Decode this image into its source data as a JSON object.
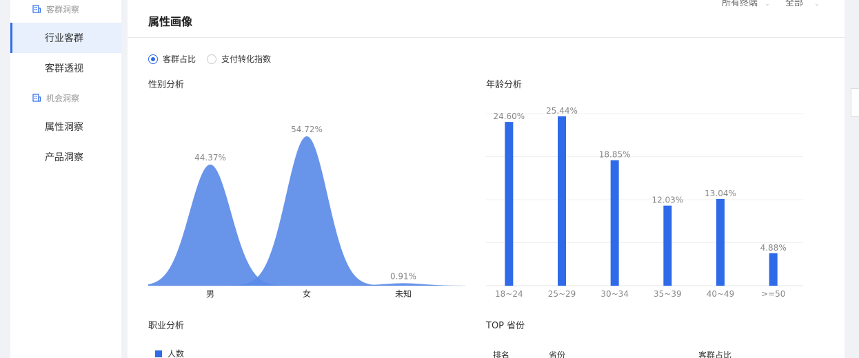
{
  "sidebar": {
    "group1": "客群洞察",
    "item_industry": "行业客群",
    "item_perspective": "客群透视",
    "group2": "机会洞察",
    "item_attr": "属性洞察",
    "item_product": "产品洞察"
  },
  "header": {
    "terminal_label": "所有终端",
    "scope_label": "全部"
  },
  "panel": {
    "title": "属性画像",
    "radio_share": "客群占比",
    "radio_index": "支付转化指数",
    "gender_title": "性别分析",
    "age_title": "年龄分析",
    "job_title": "职业分析",
    "top_title": "TOP 省份",
    "legend_people": "人数",
    "col_rank": "排名",
    "col_province": "省份",
    "col_share": "客群占比"
  },
  "colors": {
    "accent": "#2f6be8",
    "gender_fill": "#5b8be8"
  },
  "chart_data": [
    {
      "type": "area",
      "categories": [
        "男",
        "女",
        "未知"
      ],
      "values": [
        44.37,
        54.72,
        0.91
      ],
      "labels": [
        "44.37%",
        "54.72%",
        "0.91%"
      ],
      "ylim": [
        0,
        60
      ]
    },
    {
      "type": "bar",
      "categories": [
        "18~24",
        "25~29",
        "30~34",
        "35~39",
        "40~49",
        ">=50"
      ],
      "values": [
        24.6,
        25.44,
        18.85,
        12.03,
        13.04,
        4.88
      ],
      "labels": [
        "24.60%",
        "25.44%",
        "18.85%",
        "12.03%",
        "13.04%",
        "4.88%"
      ],
      "ylim": [
        0,
        25.44
      ],
      "grid": true
    }
  ]
}
